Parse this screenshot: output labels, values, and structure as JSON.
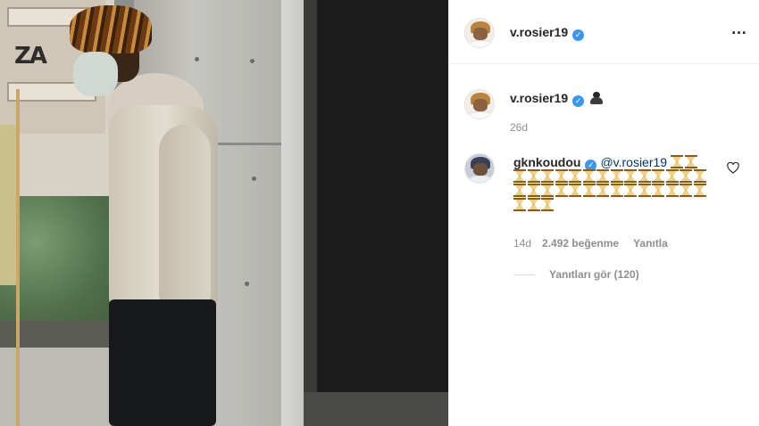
{
  "post": {
    "author": "v.rosier19",
    "more_icon": "…",
    "caption": {
      "username": "v.rosier19",
      "emoji": "ninja-emoji",
      "time": "26d"
    }
  },
  "comment": {
    "username": "gknkoudou",
    "mention": "@v.rosier19",
    "emoji": "hourglass-emoji",
    "emoji_rows": [
      2,
      14,
      14,
      3
    ],
    "time": "14d",
    "likes": "2.492 beğenme",
    "reply_label": "Yanıtla",
    "view_replies": "Yanıtları gör (120)"
  },
  "colors": {
    "verified": "#3897f0",
    "mention": "#00376b",
    "muted": "#8e8e8e",
    "text": "#262626"
  }
}
